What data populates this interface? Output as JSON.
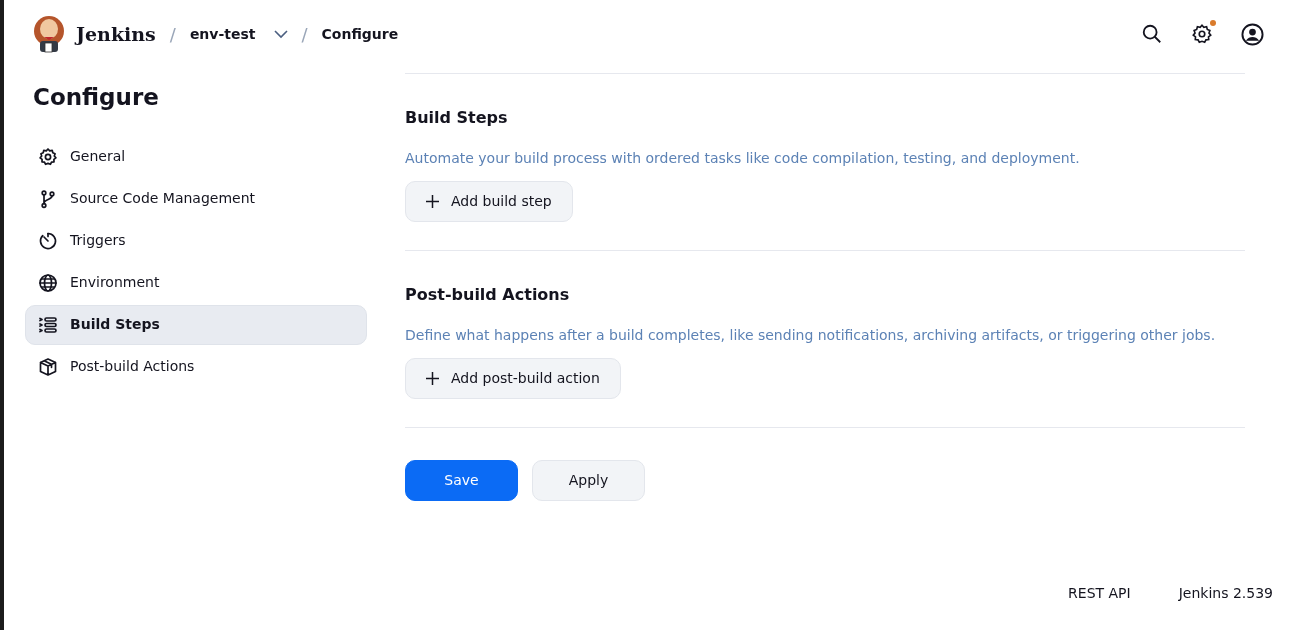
{
  "header": {
    "brand": "Jenkins",
    "breadcrumbs": [
      {
        "separator": "/",
        "label": "env-test",
        "dropdown": true
      },
      {
        "separator": "/",
        "label": "Configure",
        "dropdown": false
      }
    ],
    "settings_notification": true
  },
  "sidebar": {
    "title": "Configure",
    "items": [
      {
        "label": "General",
        "selected": false
      },
      {
        "label": "Source Code Management",
        "selected": false
      },
      {
        "label": "Triggers",
        "selected": false
      },
      {
        "label": "Environment",
        "selected": false
      },
      {
        "label": "Build Steps",
        "selected": true
      },
      {
        "label": "Post-build Actions",
        "selected": false
      }
    ]
  },
  "sections": [
    {
      "title": "Build Steps",
      "description": "Automate your build process with ordered tasks like code compilation, testing, and deployment.",
      "button": "Add build step"
    },
    {
      "title": "Post-build Actions",
      "description": "Define what happens after a build completes, like sending notifications, archiving artifacts, or triggering other jobs.",
      "button": "Add post-build action"
    }
  ],
  "actions": [
    {
      "label": "Save",
      "kind": "primary"
    },
    {
      "label": "Apply",
      "kind": "secondary"
    }
  ],
  "footer": {
    "links": [
      "REST API",
      "Jenkins 2.539"
    ]
  }
}
